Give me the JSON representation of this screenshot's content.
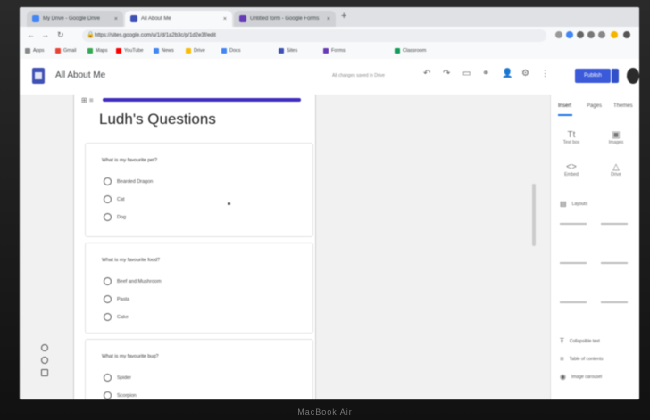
{
  "browser": {
    "tabs": [
      {
        "title": "My Drive - Google Drive",
        "color": "#4285f4",
        "active": false
      },
      {
        "title": "All About Me",
        "color": "#3f51b5",
        "active": true
      },
      {
        "title": "Untitled form - Google Forms",
        "color": "#673ab7",
        "active": false
      }
    ],
    "new_tab": "+",
    "url": "https://sites.google.com/u/1/d/1a2b3c/p/1d2e3f/edit",
    "bookmarks": [
      {
        "label": "Apps",
        "color": "#888888"
      },
      {
        "label": "Gmail",
        "color": "#ea4335"
      },
      {
        "label": "Maps",
        "color": "#34a853"
      },
      {
        "label": "YouTube",
        "color": "#ff0000"
      },
      {
        "label": "News",
        "color": "#4285f4"
      },
      {
        "label": "Drive",
        "color": "#fbbc05"
      },
      {
        "label": "Docs",
        "color": "#4285f4"
      },
      {
        "label": "Sites",
        "color": "#3f51b5"
      },
      {
        "label": "Forms",
        "color": "#673ab7"
      },
      {
        "label": "Classroom",
        "color": "#0f9d58"
      }
    ]
  },
  "app": {
    "title": "All About Me",
    "saved_status": "All changes saved in Drive",
    "publish_label": "Publish",
    "accent": "#3b5ad9"
  },
  "form": {
    "title": "Ludh's Questions",
    "bar_color": "#3f2dbf",
    "questions": [
      {
        "text": "What is my favourite pet?",
        "options": [
          "Bearded Dragon",
          "Cat",
          "Dog"
        ]
      },
      {
        "text": "What is my favourite food?",
        "options": [
          "Beef and Mushroom",
          "Pasta",
          "Cake"
        ]
      },
      {
        "text": "What is my favourite bug?",
        "options": [
          "Spider",
          "Scorpion"
        ]
      }
    ]
  },
  "panel": {
    "tabs": [
      "Insert",
      "Pages",
      "Themes"
    ],
    "insert_items": [
      {
        "label": "Text box",
        "icon": "text-box-icon"
      },
      {
        "label": "Images",
        "icon": "image-icon"
      },
      {
        "label": "Embed",
        "icon": "embed-icon"
      },
      {
        "label": "Drive",
        "icon": "drive-icon"
      }
    ],
    "layouts_label": "Layouts",
    "bottom_items": [
      {
        "label": "Collapsible text",
        "icon": "collapsible-icon"
      },
      {
        "label": "Table of contents",
        "icon": "toc-icon"
      },
      {
        "label": "Image carousel",
        "icon": "carousel-icon"
      }
    ]
  },
  "laptop_brand": "MacBook Air"
}
